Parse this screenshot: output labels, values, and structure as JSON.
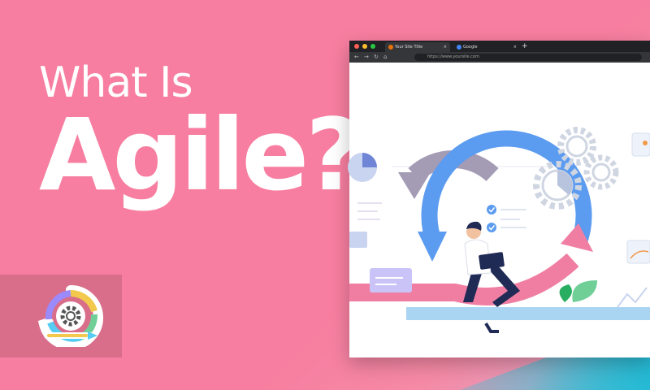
{
  "headline": {
    "line1": "What Is",
    "line2": "Agile?"
  },
  "browser": {
    "active_tab": "Your Site Title",
    "inactive_tab": "Google",
    "new_tab_symbol": "+",
    "close_symbol": "×",
    "url": "https://www.yoursite.com"
  },
  "colors": {
    "background": "#f77ea0",
    "accent_cyan": "#25b9d4",
    "cycle_blue": "#5b9bf0",
    "cycle_pink": "#f07ea3",
    "cycle_purple": "#a49bb5"
  },
  "icons": [
    "agile-cycle-logo-icon",
    "gear-icon",
    "check-icon",
    "pie-chart-icon",
    "leaf-icon",
    "person-with-laptop-icon"
  ]
}
